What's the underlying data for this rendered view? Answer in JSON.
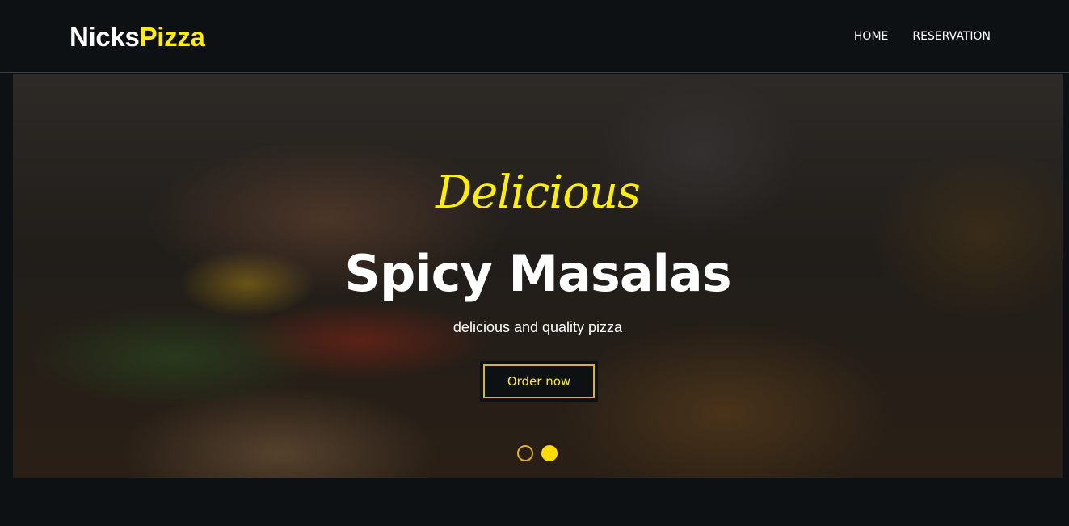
{
  "brand": {
    "part1": "Nicks",
    "part2": "Pizza"
  },
  "nav": {
    "items": [
      {
        "label": "HOME"
      },
      {
        "label": "RESERVATION"
      }
    ]
  },
  "hero": {
    "script_text": "Delicious",
    "title": "Spicy Masalas",
    "subtitle": "delicious and quality pizza",
    "cta_label": "Order now",
    "slides": {
      "count": 2,
      "active": 2
    }
  },
  "colors": {
    "accent": "#ffee00",
    "background": "#0d1114",
    "button_border": "#e0b12a"
  }
}
